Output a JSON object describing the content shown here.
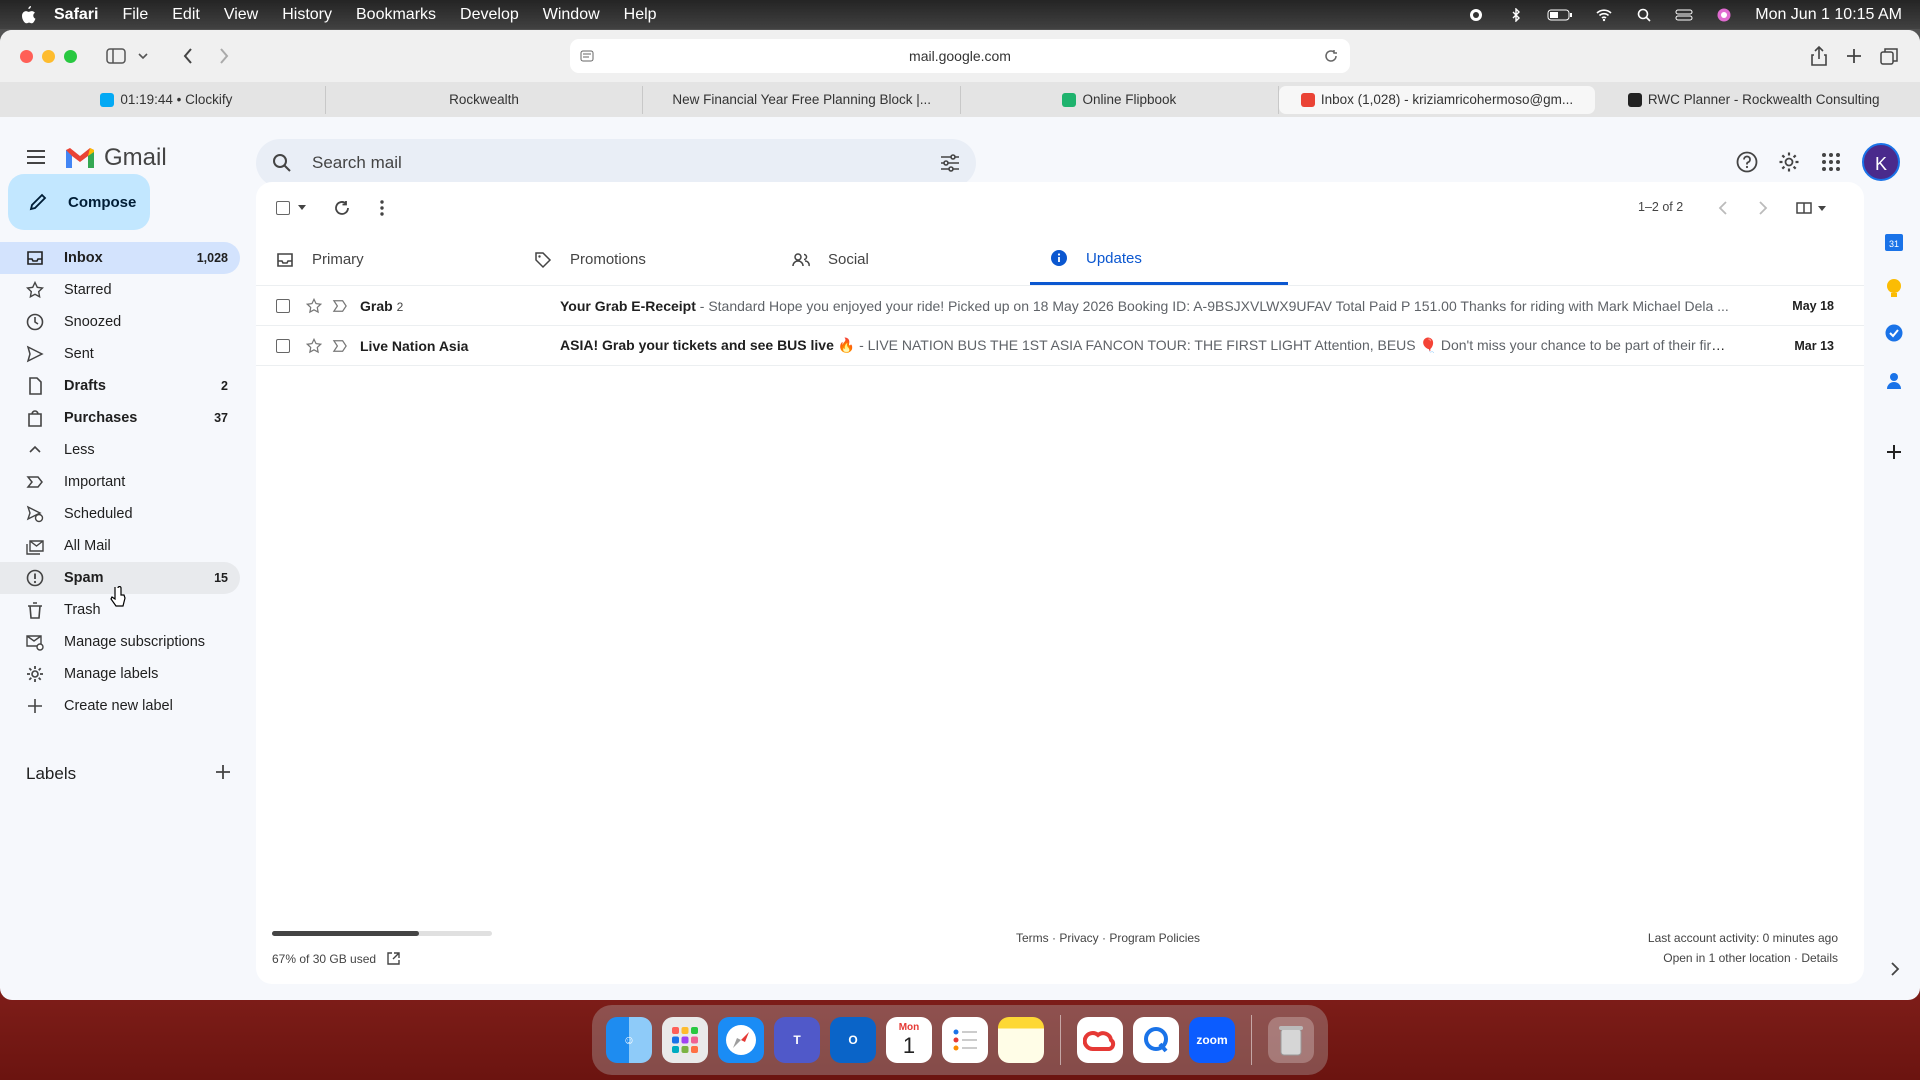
{
  "menubar": {
    "items": [
      "Safari",
      "File",
      "Edit",
      "View",
      "History",
      "Bookmarks",
      "Develop",
      "Window",
      "Help"
    ],
    "datetime": "Mon Jun 1  10:15 AM"
  },
  "browser": {
    "url": "mail.google.com",
    "tabs": [
      {
        "label": "01:19:44 • Clockify",
        "favicon_color": "#03a9f4"
      },
      {
        "label": "Rockwealth"
      },
      {
        "label": "New Financial Year Free Planning Block |..."
      },
      {
        "label": "Online Flipbook",
        "favicon_color": "#1fb36e"
      },
      {
        "label": "Inbox (1,028) - kriziamricohermoso@gm...",
        "favicon_color": "#ea4335",
        "active": true
      },
      {
        "label": "RWC Planner - Rockwealth Consulting",
        "favicon_color": "#222222"
      }
    ]
  },
  "gmail": {
    "logo_text": "Gmail",
    "search_placeholder": "Search mail",
    "avatar_letter": "K",
    "compose": "Compose",
    "nav": [
      {
        "label": "Inbox",
        "count": "1,028",
        "bold": true,
        "selected": true,
        "icon": "inbox-icon"
      },
      {
        "label": "Starred",
        "icon": "star-icon"
      },
      {
        "label": "Snoozed",
        "icon": "clock-icon"
      },
      {
        "label": "Sent",
        "icon": "send-icon"
      },
      {
        "label": "Drafts",
        "count": "2",
        "bold": true,
        "icon": "draft-icon"
      },
      {
        "label": "Purchases",
        "count": "37",
        "bold": true,
        "icon": "purchases-icon"
      },
      {
        "label": "Less",
        "icon": "chevron-up-icon"
      },
      {
        "label": "Important",
        "icon": "important-icon"
      },
      {
        "label": "Scheduled",
        "icon": "scheduled-icon"
      },
      {
        "label": "All Mail",
        "icon": "all-mail-icon"
      },
      {
        "label": "Spam",
        "count": "15",
        "bold": true,
        "hover": true,
        "icon": "spam-icon"
      },
      {
        "label": "Trash",
        "icon": "trash-icon"
      },
      {
        "label": "Manage subscriptions",
        "icon": "subscriptions-icon"
      },
      {
        "label": "Manage labels",
        "icon": "gear-icon"
      },
      {
        "label": "Create new label",
        "icon": "plus-icon"
      }
    ],
    "labels_heading": "Labels",
    "pager": "1–2 of 2",
    "categories": [
      {
        "label": "Primary",
        "icon": "inbox-icon"
      },
      {
        "label": "Promotions",
        "icon": "tag-icon"
      },
      {
        "label": "Social",
        "icon": "people-icon"
      },
      {
        "label": "Updates",
        "icon": "info-icon",
        "active": true
      }
    ],
    "emails": [
      {
        "sender": "Grab",
        "thread_count": "2",
        "subject": "Your Grab E-Receipt",
        "snippet": " - Standard Hope you enjoyed your ride! Picked up on 18 May 2026 Booking ID: A-9BSJXVLWX9UFAV Total Paid P 151.00 Thanks for riding with Mark Michael Dela ...",
        "date": "May 18"
      },
      {
        "sender": "Live Nation Asia",
        "thread_count": "",
        "subject": "ASIA! Grab your tickets and see BUS live 🔥",
        "snippet": " - LIVE NATION BUS THE 1ST ASIA FANCON TOUR: THE FIRST LIGHT Attention, BEUS 🎈 Don't miss your chance to be part of their first Asi...",
        "date": "Mar 13"
      }
    ],
    "footer": {
      "storage": "67% of 30 GB used",
      "storage_fraction": 0.67,
      "links": "Terms · Privacy · Program Policies",
      "activity": "Last account activity: 0 minutes ago",
      "activity2": "Open in 1 other location · Details"
    }
  },
  "dock": {
    "calendar_month": "Mon",
    "calendar_day": "1",
    "zoom": "zoom"
  },
  "colors": {
    "accent": "#0b57d0",
    "compose_bg": "#c2e7ff",
    "selected_nav": "#d3e3fd"
  }
}
